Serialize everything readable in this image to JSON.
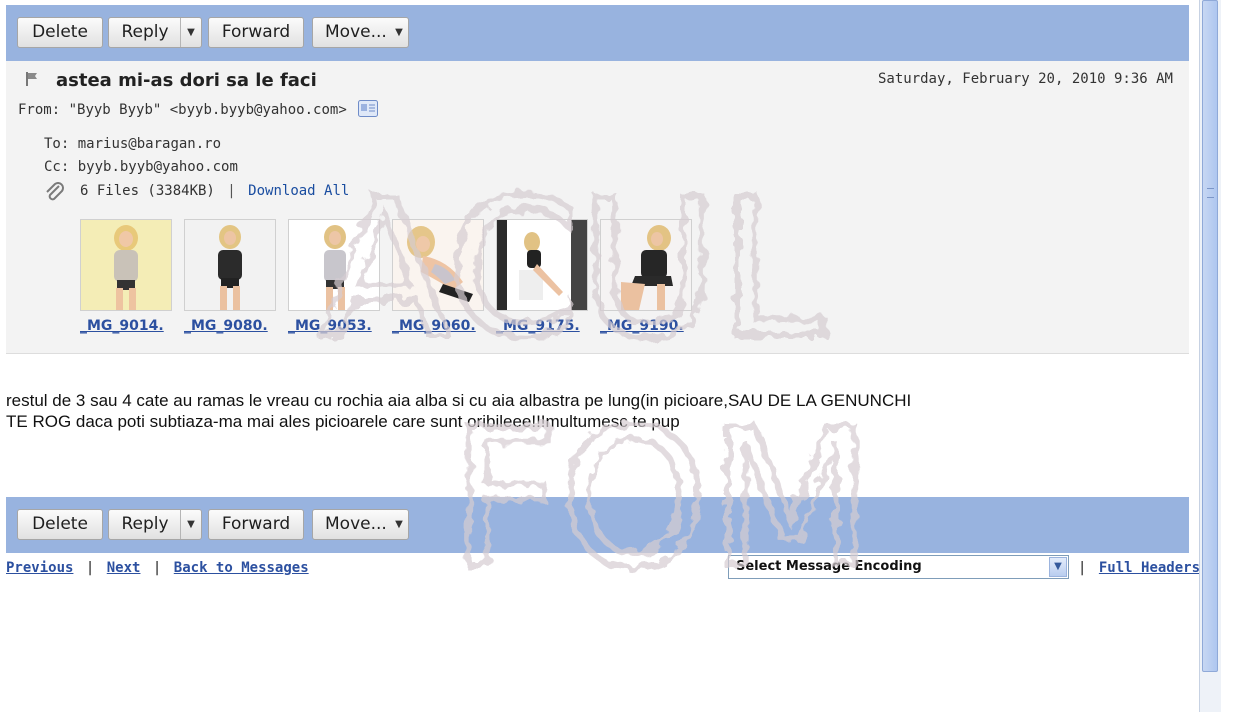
{
  "toolbar": {
    "delete_label": "Delete",
    "reply_label": "Reply",
    "forward_label": "Forward",
    "move_label": "Move..."
  },
  "message": {
    "subject": "astea mi-as dori sa le faci",
    "date": "Saturday, February 20, 2010 9:36 AM",
    "from_label": "From:",
    "from_value": "\"Byyb Byyb\" <byyb.byyb@yahoo.com>",
    "to_label": "To:",
    "to_value": "marius@baragan.ro",
    "cc_label": "Cc:",
    "cc_value": "byyb.byyb@yahoo.com",
    "files_summary": "6 Files (3384KB)",
    "separator": "|",
    "download_all": "Download All"
  },
  "attachments": [
    {
      "name": "_MG_9014."
    },
    {
      "name": "_MG_9080."
    },
    {
      "name": "_MG_9053."
    },
    {
      "name": "_MG_9060."
    },
    {
      "name": "_MG_9175."
    },
    {
      "name": "_MG_9190."
    }
  ],
  "body": {
    "line1": "restul de 3 sau 4 cate au ramas le vreau cu rochia aia alba si cu aia albastra pe lung(in picioare,SAU DE LA GENUNCHI",
    "line2": "TE ROG daca poti subtiaza-ma mai ales picioarele care sunt oribileee!!!multumesc te pup"
  },
  "footer": {
    "previous": "Previous",
    "next": "Next",
    "back": "Back to Messages",
    "separator": "|",
    "encoding_value": "Select Message Encoding",
    "full_headers": "Full Headers"
  },
  "watermark": {
    "line1": "ACUL",
    "line2": "FOM"
  },
  "colors": {
    "toolbar_bg": "#98b3df",
    "header_bg": "#f3f3f3",
    "link": "#2c50a0"
  },
  "icons": [
    "flag-icon",
    "address-card-icon",
    "paperclip-icon",
    "chevron-down-icon"
  ]
}
